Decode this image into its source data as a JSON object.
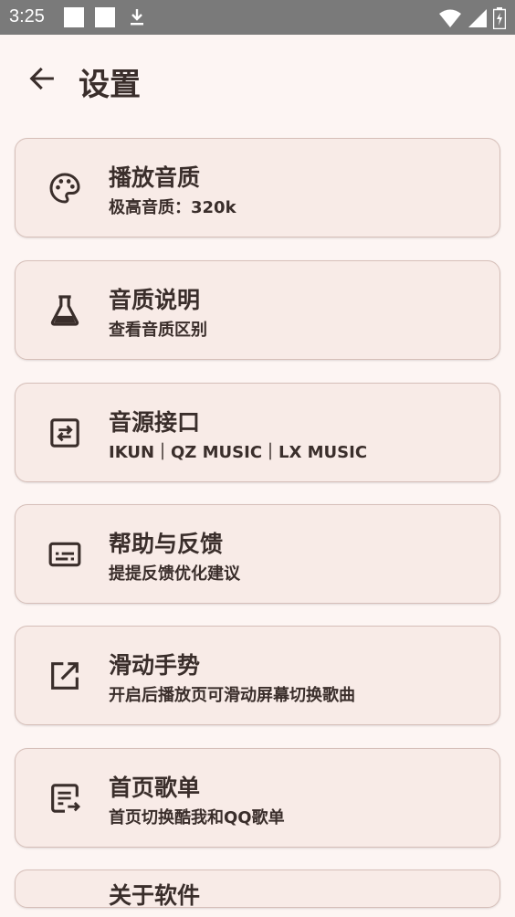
{
  "status_bar": {
    "time": "3:25"
  },
  "header": {
    "title": "设置"
  },
  "settings": [
    {
      "title": "播放音质",
      "subtitle": "极高音质：320k",
      "icon": "palette-icon"
    },
    {
      "title": "音质说明",
      "subtitle": "查看音质区别",
      "icon": "flask-icon"
    },
    {
      "title": "音源接口",
      "subtitle": "IKUN｜QZ MUSIC｜LX MUSIC",
      "icon": "swap-icon"
    },
    {
      "title": "帮助与反馈",
      "subtitle": "提提反馈优化建议",
      "icon": "subtitles-icon"
    },
    {
      "title": "滑动手势",
      "subtitle": "开启后播放页可滑动屏幕切换歌曲",
      "icon": "open-in-new-icon"
    },
    {
      "title": "首页歌单",
      "subtitle": "首页切换酷我和QQ歌单",
      "icon": "playlist-icon"
    },
    {
      "title": "关于软件",
      "subtitle": "",
      "icon": ""
    }
  ],
  "colors": {
    "background": "#fdf5f3",
    "card": "#f8ebe7",
    "card_border": "#d6bfb9",
    "text": "#3a2e2b",
    "status_bar": "#7a7a7a"
  }
}
